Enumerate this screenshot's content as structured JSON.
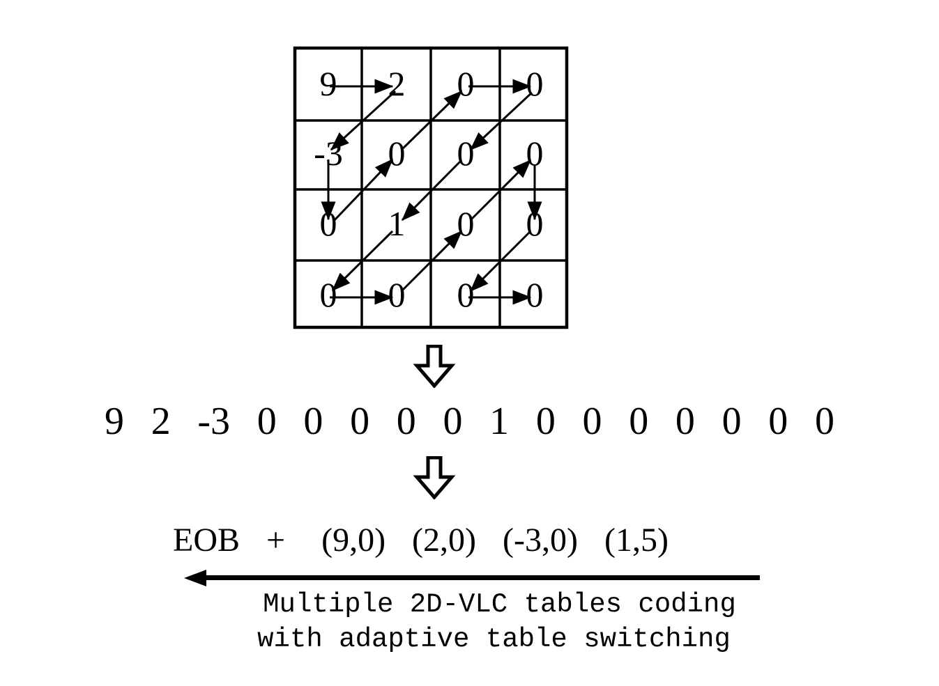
{
  "figure": {
    "title": "Zigzag scan of a 4x4 transform block followed by 2D-VLC coding",
    "stroke_color": "#000000",
    "background_color": "#ffffff"
  },
  "matrix": {
    "rows": 4,
    "cols": 4,
    "values": [
      [
        "9",
        "2",
        "0",
        "0"
      ],
      [
        "-3",
        "0",
        "0",
        "0"
      ],
      [
        "0",
        "1",
        "0",
        "0"
      ],
      [
        "0",
        "0",
        "0",
        "0"
      ]
    ],
    "scan_order_name": "zigzag-scan"
  },
  "arrows": {
    "down_arrow_1": "down-block-arrow",
    "down_arrow_2": "down-block-arrow",
    "left_arrow": "left-arrow"
  },
  "sequence": {
    "label": "scanned-coefficients",
    "coefficients": [
      "9",
      "2",
      "-3",
      "0",
      "0",
      "0",
      "0",
      "0",
      "1",
      "0",
      "0",
      "0",
      "0",
      "0",
      "0",
      "0"
    ]
  },
  "rle": {
    "eob_label": "EOB",
    "plus_label": "+",
    "pairs": [
      "(9,0)",
      "(2,0)",
      "(-3,0)",
      "(1,5)"
    ]
  },
  "caption": {
    "line1": "Multiple 2D-VLC tables coding",
    "line2": "with adaptive table switching"
  }
}
